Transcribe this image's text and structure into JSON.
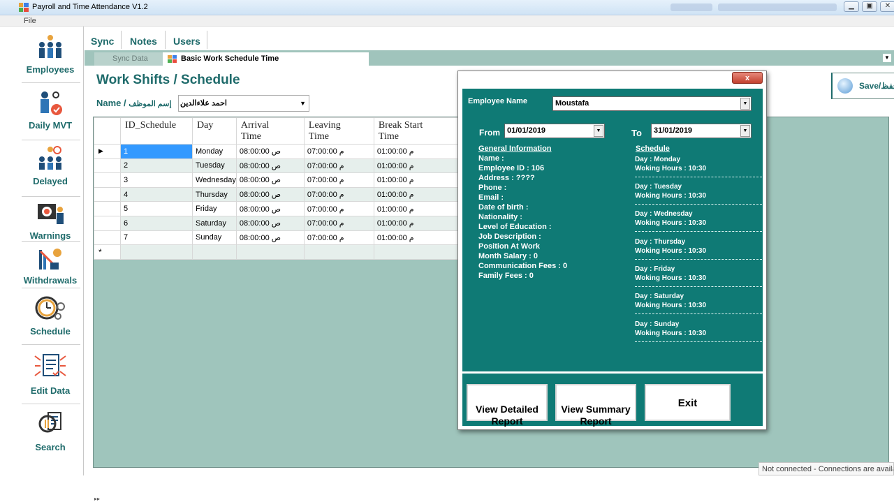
{
  "window": {
    "title": "Payroll and Time Attendance V1.2",
    "menu_file": "File"
  },
  "sidebar": {
    "items": [
      {
        "label": "Employees",
        "icon": "employees-icon"
      },
      {
        "label": "Daily MVT",
        "icon": "daily-mvt-icon"
      },
      {
        "label": "Delayed",
        "icon": "delayed-icon"
      },
      {
        "label": "Warnings",
        "icon": "warnings-icon"
      },
      {
        "label": "Withdrawals",
        "icon": "withdrawals-icon"
      },
      {
        "label": "Schedule",
        "icon": "schedule-icon"
      },
      {
        "label": "Edit Data",
        "icon": "edit-data-icon"
      },
      {
        "label": "Search",
        "icon": "search-icon"
      }
    ]
  },
  "topmenu": {
    "sync": "Sync",
    "notes": "Notes",
    "users": "Users"
  },
  "tabs": {
    "sync_data": "Sync Data",
    "basic_schedule": "Basic Work Schedule Time"
  },
  "page": {
    "title": "Work  Shifts / Schedule",
    "name_label": "Name /",
    "name_label_ar": "إسم الموظف",
    "name_value": "احمد علاءالدين",
    "save_label": "Save/حفظ"
  },
  "grid": {
    "columns": [
      "ID_Schedule",
      "Day",
      "Arrival\nTime",
      "Leaving\nTime",
      "Break Start\nTime"
    ],
    "rows": [
      {
        "id": "1",
        "day": "Monday",
        "arrival": "08:00:00 ص",
        "leaving": "07:00:00 م",
        "break": "01:00:00 م"
      },
      {
        "id": "2",
        "day": "Tuesday",
        "arrival": "08:00:00 ص",
        "leaving": "07:00:00 م",
        "break": "01:00:00 م"
      },
      {
        "id": "3",
        "day": "Wednesday",
        "arrival": "08:00:00 ص",
        "leaving": "07:00:00 م",
        "break": "01:00:00 م"
      },
      {
        "id": "4",
        "day": "Thursday",
        "arrival": "08:00:00 ص",
        "leaving": "07:00:00 م",
        "break": "01:00:00 م"
      },
      {
        "id": "5",
        "day": "Friday",
        "arrival": "08:00:00 ص",
        "leaving": "07:00:00 م",
        "break": "01:00:00 م"
      },
      {
        "id": "6",
        "day": "Saturday",
        "arrival": "08:00:00 ص",
        "leaving": "07:00:00 م",
        "break": "01:00:00 م"
      },
      {
        "id": "7",
        "day": "Sunday",
        "arrival": "08:00:00 ص",
        "leaving": "07:00:00 م",
        "break": "01:00:00 م"
      }
    ],
    "new_row_marker": "*",
    "current_row_marker": "▶"
  },
  "dialog": {
    "close_label": "x",
    "employee_name_label": "Employee Name",
    "employee_name_value": "Moustafa",
    "from_label": "From",
    "from_value": "01/01/2019",
    "to_label": "To",
    "to_value": "31/01/2019",
    "general_header": "General Information",
    "general_lines": [
      "Name :",
      "Employee ID : 106",
      "Address : ????",
      "Phone :",
      "Email :",
      "Date of birth :",
      "Nationality :",
      "Level of Education :",
      "Job Description :",
      "Position At Work",
      "Month Salary : 0",
      "Communication Fees : 0",
      "Family Fees : 0"
    ],
    "schedule_header": "Schedule",
    "schedule": [
      {
        "day": "Day : Monday",
        "hours": "Woking Hours : 10:30"
      },
      {
        "day": "Day : Tuesday",
        "hours": "Woking Hours : 10:30"
      },
      {
        "day": "Day : Wednesday",
        "hours": "Woking Hours : 10:30"
      },
      {
        "day": "Day : Thursday",
        "hours": "Woking Hours : 10:30"
      },
      {
        "day": "Day : Friday",
        "hours": "Woking Hours : 10:30"
      },
      {
        "day": "Day : Saturday",
        "hours": "Woking Hours : 10:30"
      },
      {
        "day": "Day : Sunday",
        "hours": "Woking Hours : 10:30"
      }
    ],
    "btn_detailed": "View Detailed\nReport",
    "btn_summary": "View Summary\nReport",
    "btn_exit": "Exit"
  },
  "status": {
    "text": "Not connected - Connections are available"
  },
  "colors": {
    "teal_dark": "#0f7a75",
    "teal_text": "#1f6b6b",
    "grid_bg": "#9fc5bc",
    "selection": "#3399ff"
  }
}
